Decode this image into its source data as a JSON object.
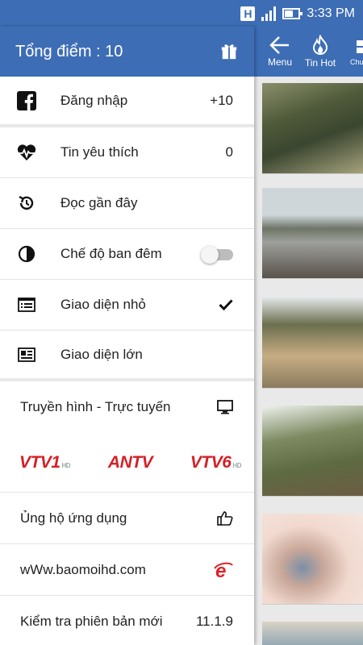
{
  "status_bar": {
    "time": "3:33 PM",
    "network_indicator": "H"
  },
  "drawer": {
    "title": "Tổng điểm : 10",
    "items": [
      {
        "icon": "facebook-icon",
        "label": "Đăng nhập",
        "value": "+10"
      },
      {
        "icon": "heartbeat-icon",
        "label": "Tin yêu thích",
        "value": "0"
      },
      {
        "icon": "history-icon",
        "label": "Đọc gần đây",
        "value": ""
      },
      {
        "icon": "contrast-icon",
        "label": "Chế độ ban đêm",
        "toggle": "off"
      },
      {
        "icon": "list-small-icon",
        "label": "Giao diện nhỏ",
        "checked": true
      },
      {
        "icon": "list-large-icon",
        "label": "Giao diện lớn",
        "checked": false
      }
    ],
    "tv": {
      "label": "Truyền hình - Trực tuyến",
      "channels": [
        {
          "name": "VTV1",
          "suffix": "HD"
        },
        {
          "name": "ANTV",
          "suffix": ""
        },
        {
          "name": "VTV6",
          "suffix": "HD"
        }
      ]
    },
    "support_label": "Ủng hộ ứng dụng",
    "website_label": "wWw.baomoihd.com",
    "version_label": "Kiểm tra phiên bản mới",
    "version_value": "11.1.9"
  },
  "topbar": {
    "tabs": [
      {
        "label": "Menu",
        "icon": "back-arrow-icon"
      },
      {
        "label": "Tin Hot",
        "icon": "fire-icon"
      },
      {
        "label": "Chuyê",
        "icon": "category-icon"
      }
    ]
  },
  "colors": {
    "primary": "#3d6db5",
    "accent_red": "#d51f26"
  }
}
